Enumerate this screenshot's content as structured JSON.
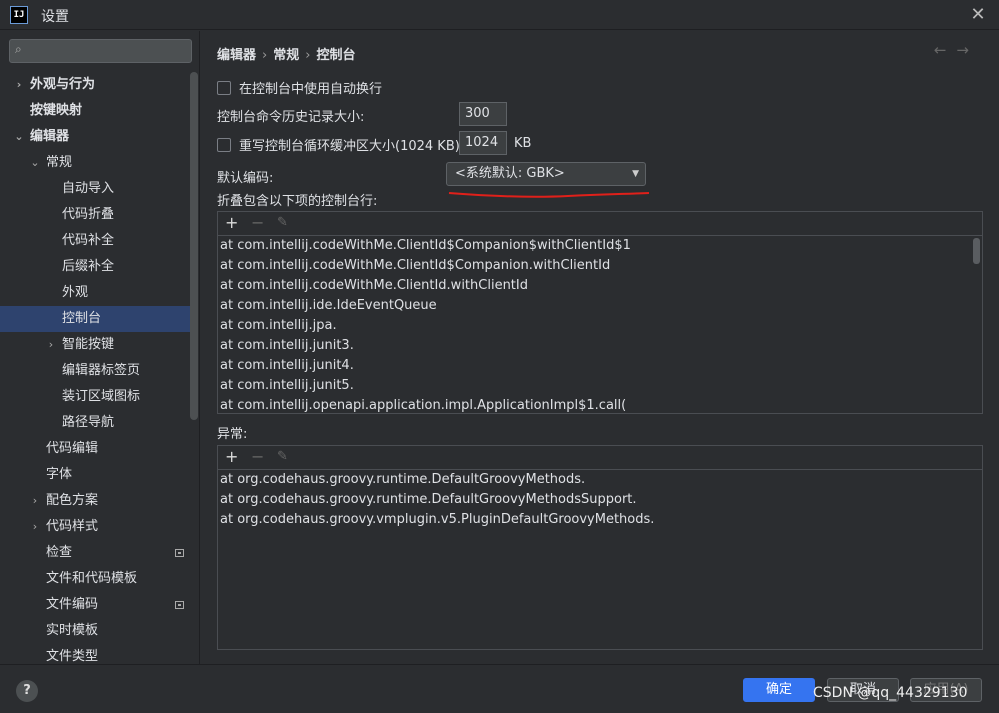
{
  "window": {
    "title": "设置",
    "app_icon_text": "IJ"
  },
  "sidebar": {
    "search_placeholder": "",
    "items": [
      {
        "label": "外观与行为",
        "level": 0,
        "chevron": "›",
        "bold": true
      },
      {
        "label": "按键映射",
        "level": 0,
        "chevron": "",
        "bold": true
      },
      {
        "label": "编辑器",
        "level": 0,
        "chevron": "⌄",
        "bold": true
      },
      {
        "label": "常规",
        "level": 1,
        "chevron": "⌄"
      },
      {
        "label": "自动导入",
        "level": 2,
        "chevron": ""
      },
      {
        "label": "代码折叠",
        "level": 2,
        "chevron": ""
      },
      {
        "label": "代码补全",
        "level": 2,
        "chevron": ""
      },
      {
        "label": "后缀补全",
        "level": 2,
        "chevron": ""
      },
      {
        "label": "外观",
        "level": 2,
        "chevron": ""
      },
      {
        "label": "控制台",
        "level": 2,
        "chevron": "",
        "selected": true
      },
      {
        "label": "智能按键",
        "level": 2,
        "chevron": "›"
      },
      {
        "label": "编辑器标签页",
        "level": 2,
        "chevron": ""
      },
      {
        "label": "装订区域图标",
        "level": 2,
        "chevron": ""
      },
      {
        "label": "路径导航",
        "level": 2,
        "chevron": ""
      },
      {
        "label": "代码编辑",
        "level": 1,
        "chevron": ""
      },
      {
        "label": "字体",
        "level": 1,
        "chevron": ""
      },
      {
        "label": "配色方案",
        "level": 1,
        "chevron": "›"
      },
      {
        "label": "代码样式",
        "level": 1,
        "chevron": "›"
      },
      {
        "label": "检查",
        "level": 1,
        "chevron": "",
        "badge": true
      },
      {
        "label": "文件和代码模板",
        "level": 1,
        "chevron": ""
      },
      {
        "label": "文件编码",
        "level": 1,
        "chevron": "",
        "badge": true
      },
      {
        "label": "实时模板",
        "level": 1,
        "chevron": ""
      },
      {
        "label": "文件类型",
        "level": 1,
        "chevron": ""
      }
    ]
  },
  "breadcrumb": {
    "part1": "编辑器",
    "part2": "常规",
    "part3": "控制台",
    "sep": "›"
  },
  "nav": {
    "back": "←",
    "forward": "→"
  },
  "settings": {
    "soft_wrap_label": "在控制台中使用自动换行",
    "history_label": "控制台命令历史记录大小:",
    "history_value": "300",
    "buffer_label": "重写控制台循环缓冲区大小(1024 KB)",
    "buffer_value": "1024",
    "buffer_unit": "KB",
    "encoding_label": "默认编码:",
    "encoding_value": "<系统默认: GBK>",
    "fold_label": "折叠包含以下项的控制台行:",
    "exceptions_label": "异常:"
  },
  "toolbar": {
    "add": "+",
    "remove": "−",
    "edit": "✎"
  },
  "fold_lines": [
    "at com.intellij.codeWithMe.ClientId$Companion$withClientId$1",
    "at com.intellij.codeWithMe.ClientId$Companion.withClientId",
    "at com.intellij.codeWithMe.ClientId.withClientId",
    "at com.intellij.ide.IdeEventQueue",
    "at com.intellij.jpa.",
    "at com.intellij.junit3.",
    "at com.intellij.junit4.",
    "at com.intellij.junit5.",
    "at com.intellij.openapi.application.impl.ApplicationImpl$1.call("
  ],
  "exception_lines": [
    "at org.codehaus.groovy.runtime.DefaultGroovyMethods.",
    "at org.codehaus.groovy.runtime.DefaultGroovyMethodsSupport.",
    "at org.codehaus.groovy.vmplugin.v5.PluginDefaultGroovyMethods."
  ],
  "footer": {
    "help": "?",
    "ok": "确定",
    "cancel": "取消",
    "apply": "应用(A)",
    "watermark": "CSDN @qq_44329130"
  },
  "colors": {
    "accent": "#3574f0",
    "selection": "#2e436e",
    "annotation": "#e0201a"
  }
}
